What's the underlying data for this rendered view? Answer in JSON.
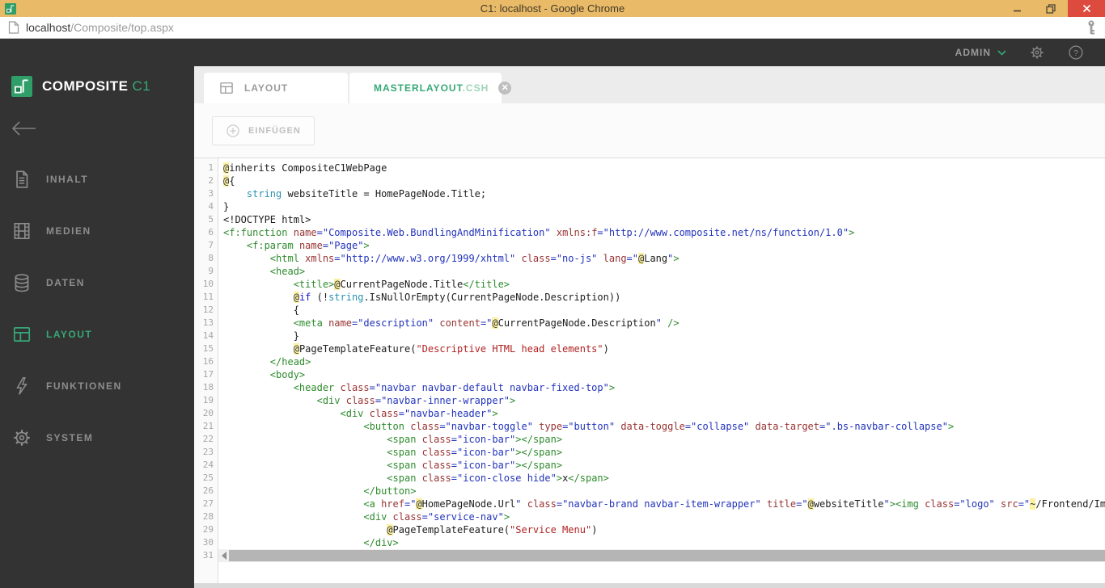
{
  "chrome": {
    "window_title": "C1: localhost - Google Chrome",
    "url_host": "localhost",
    "url_path": "/Composite/top.aspx"
  },
  "colors": {
    "accent": "#36a877",
    "titlebar": "#e9ba67",
    "close_button": "#dd4b3e",
    "sidebar_bg": "#333333",
    "tag_green": "#2e8b2e",
    "attr_red": "#993333",
    "value_blue": "#2233bb",
    "type_teal": "#2b91af",
    "string_red": "#b22222",
    "razor_highlight": "#fbf1a3"
  },
  "topbar": {
    "user_label": "ADMIN"
  },
  "sidebar": {
    "brand": {
      "name": "COMPOSITE",
      "suffix": "C1"
    },
    "items": [
      {
        "label": "INHALT",
        "icon": "document-icon",
        "active": false
      },
      {
        "label": "MEDIEN",
        "icon": "film-icon",
        "active": false
      },
      {
        "label": "DATEN",
        "icon": "database-icon",
        "active": false
      },
      {
        "label": "LAYOUT",
        "icon": "layout-icon",
        "active": true
      },
      {
        "label": "FUNKTIONEN",
        "icon": "bolt-icon",
        "active": false
      },
      {
        "label": "SYSTEM",
        "icon": "gear-icon",
        "active": false
      }
    ]
  },
  "tabs": [
    {
      "label": "LAYOUT",
      "icon": "layout-icon",
      "active": false
    },
    {
      "label": "MASTERLAYOUT",
      "label_ext": ".CSH",
      "icon": "pencil-icon",
      "active": true,
      "closable": true
    }
  ],
  "toolbar": {
    "insert_label": "EINFÜGEN"
  },
  "editor": {
    "last_line_number": 31,
    "lines": [
      [
        [
          "hl",
          "@"
        ],
        [
          "p",
          "inherits CompositeC1WebPage"
        ]
      ],
      [
        [
          "hl",
          "@"
        ],
        [
          "p",
          "{"
        ]
      ],
      [
        [
          "p",
          "    "
        ],
        [
          "ty",
          "string"
        ],
        [
          "p",
          " websiteTitle = HomePageNode.Title;"
        ]
      ],
      [
        [
          "p",
          "}"
        ]
      ],
      [
        [
          "p",
          "<!DOCTYPE html>"
        ]
      ],
      [
        [
          "t",
          "<f:function"
        ],
        [
          "p",
          " "
        ],
        [
          "an",
          "name"
        ],
        [
          "av",
          "=\"Composite.Web.BundlingAndMinification\""
        ],
        [
          "p",
          " "
        ],
        [
          "an",
          "xmlns:f"
        ],
        [
          "av",
          "=\"http://www.composite.net/ns/function/1.0\""
        ],
        [
          "t",
          ">"
        ]
      ],
      [
        [
          "p",
          "    "
        ],
        [
          "t",
          "<f:param"
        ],
        [
          "p",
          " "
        ],
        [
          "an",
          "name"
        ],
        [
          "av",
          "=\"Page\""
        ],
        [
          "t",
          ">"
        ]
      ],
      [
        [
          "p",
          "        "
        ],
        [
          "t",
          "<html"
        ],
        [
          "p",
          " "
        ],
        [
          "an",
          "xmlns"
        ],
        [
          "av",
          "=\"http://www.w3.org/1999/xhtml\""
        ],
        [
          "p",
          " "
        ],
        [
          "an",
          "class"
        ],
        [
          "av",
          "=\"no-js\""
        ],
        [
          "p",
          " "
        ],
        [
          "an",
          "lang"
        ],
        [
          "av",
          "=\""
        ],
        [
          "hl",
          "@"
        ],
        [
          "p",
          "Lang"
        ],
        [
          "av",
          "\""
        ],
        [
          "t",
          ">"
        ]
      ],
      [
        [
          "p",
          "        "
        ],
        [
          "t",
          "<head>"
        ]
      ],
      [
        [
          "p",
          "            "
        ],
        [
          "t",
          "<title>"
        ],
        [
          "hl",
          "@"
        ],
        [
          "p",
          "CurrentPageNode.Title"
        ],
        [
          "t",
          "</title>"
        ]
      ],
      [
        [
          "p",
          "            "
        ],
        [
          "hl",
          "@"
        ],
        [
          "k",
          "if"
        ],
        [
          "p",
          " (!"
        ],
        [
          "ty",
          "string"
        ],
        [
          "p",
          ".IsNullOrEmpty(CurrentPageNode.Description))"
        ]
      ],
      [
        [
          "p",
          "            {"
        ]
      ],
      [
        [
          "p",
          "            "
        ],
        [
          "t",
          "<meta"
        ],
        [
          "p",
          " "
        ],
        [
          "an",
          "name"
        ],
        [
          "av",
          "=\"description\""
        ],
        [
          "p",
          " "
        ],
        [
          "an",
          "content"
        ],
        [
          "av",
          "=\""
        ],
        [
          "hl",
          "@"
        ],
        [
          "p",
          "CurrentPageNode.Description"
        ],
        [
          "av",
          "\""
        ],
        [
          "p",
          " "
        ],
        [
          "t",
          "/>"
        ]
      ],
      [
        [
          "p",
          "            }"
        ]
      ],
      [
        [
          "p",
          "            "
        ],
        [
          "hl",
          "@"
        ],
        [
          "p",
          "PageTemplateFeature("
        ],
        [
          "s",
          "\"Descriptive HTML head elements\""
        ],
        [
          "p",
          ")"
        ]
      ],
      [
        [
          "p",
          "        "
        ],
        [
          "t",
          "</head>"
        ]
      ],
      [
        [
          "p",
          "        "
        ],
        [
          "t",
          "<body>"
        ]
      ],
      [
        [
          "p",
          "            "
        ],
        [
          "t",
          "<header"
        ],
        [
          "p",
          " "
        ],
        [
          "an",
          "class"
        ],
        [
          "av",
          "=\"navbar navbar-default navbar-fixed-top\""
        ],
        [
          "t",
          ">"
        ]
      ],
      [
        [
          "p",
          "                "
        ],
        [
          "t",
          "<div"
        ],
        [
          "p",
          " "
        ],
        [
          "an",
          "class"
        ],
        [
          "av",
          "=\"navbar-inner-wrapper\""
        ],
        [
          "t",
          ">"
        ]
      ],
      [
        [
          "p",
          "                    "
        ],
        [
          "t",
          "<div"
        ],
        [
          "p",
          " "
        ],
        [
          "an",
          "class"
        ],
        [
          "av",
          "=\"navbar-header\""
        ],
        [
          "t",
          ">"
        ]
      ],
      [
        [
          "p",
          "                        "
        ],
        [
          "t",
          "<button"
        ],
        [
          "p",
          " "
        ],
        [
          "an",
          "class"
        ],
        [
          "av",
          "=\"navbar-toggle\""
        ],
        [
          "p",
          " "
        ],
        [
          "an",
          "type"
        ],
        [
          "av",
          "=\"button\""
        ],
        [
          "p",
          " "
        ],
        [
          "an",
          "data-toggle"
        ],
        [
          "av",
          "=\"collapse\""
        ],
        [
          "p",
          " "
        ],
        [
          "an",
          "data-target"
        ],
        [
          "av",
          "=\".bs-navbar-collapse\""
        ],
        [
          "t",
          ">"
        ]
      ],
      [
        [
          "p",
          "                            "
        ],
        [
          "t",
          "<span"
        ],
        [
          "p",
          " "
        ],
        [
          "an",
          "class"
        ],
        [
          "av",
          "=\"icon-bar\""
        ],
        [
          "t",
          "></span>"
        ]
      ],
      [
        [
          "p",
          "                            "
        ],
        [
          "t",
          "<span"
        ],
        [
          "p",
          " "
        ],
        [
          "an",
          "class"
        ],
        [
          "av",
          "=\"icon-bar\""
        ],
        [
          "t",
          "></span>"
        ]
      ],
      [
        [
          "p",
          "                            "
        ],
        [
          "t",
          "<span"
        ],
        [
          "p",
          " "
        ],
        [
          "an",
          "class"
        ],
        [
          "av",
          "=\"icon-bar\""
        ],
        [
          "t",
          "></span>"
        ]
      ],
      [
        [
          "p",
          "                            "
        ],
        [
          "t",
          "<span"
        ],
        [
          "p",
          " "
        ],
        [
          "an",
          "class"
        ],
        [
          "av",
          "=\"icon-close hide\""
        ],
        [
          "t",
          ">"
        ],
        [
          "p",
          "x"
        ],
        [
          "t",
          "</span>"
        ]
      ],
      [
        [
          "p",
          "                        "
        ],
        [
          "t",
          "</button>"
        ]
      ],
      [
        [
          "p",
          "                        "
        ],
        [
          "t",
          "<a"
        ],
        [
          "p",
          " "
        ],
        [
          "an",
          "href"
        ],
        [
          "av",
          "=\""
        ],
        [
          "hl",
          "@"
        ],
        [
          "p",
          "HomePageNode.Url"
        ],
        [
          "av",
          "\""
        ],
        [
          "p",
          " "
        ],
        [
          "an",
          "class"
        ],
        [
          "av",
          "=\"navbar-brand navbar-item-wrapper\""
        ],
        [
          "p",
          " "
        ],
        [
          "an",
          "title"
        ],
        [
          "av",
          "=\""
        ],
        [
          "hl",
          "@"
        ],
        [
          "p",
          "websiteTitle"
        ],
        [
          "av",
          "\""
        ],
        [
          "t",
          "><img"
        ],
        [
          "p",
          " "
        ],
        [
          "an",
          "class"
        ],
        [
          "av",
          "=\"logo\""
        ],
        [
          "p",
          " "
        ],
        [
          "an",
          "src"
        ],
        [
          "av",
          "=\""
        ],
        [
          "hl",
          "~"
        ],
        [
          "p",
          "/Frontend/Imag"
        ]
      ],
      [
        [
          "p",
          "                        "
        ],
        [
          "t",
          "<div"
        ],
        [
          "p",
          " "
        ],
        [
          "an",
          "class"
        ],
        [
          "av",
          "=\"service-nav\""
        ],
        [
          "t",
          ">"
        ]
      ],
      [
        [
          "p",
          "                            "
        ],
        [
          "hl",
          "@"
        ],
        [
          "p",
          "PageTemplateFeature("
        ],
        [
          "s",
          "\"Service Menu\""
        ],
        [
          "p",
          ")"
        ]
      ],
      [
        [
          "p",
          "                        "
        ],
        [
          "t",
          "</div>"
        ]
      ]
    ]
  }
}
